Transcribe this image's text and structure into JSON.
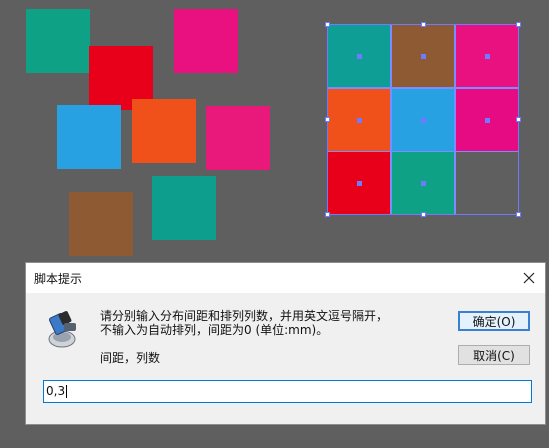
{
  "canvas": {
    "squares": [
      {
        "name": "teal-square",
        "color": "#0fa185"
      },
      {
        "name": "magenta-square",
        "color": "#e8117f"
      },
      {
        "name": "red-square",
        "color": "#e8001a"
      },
      {
        "name": "blue-square",
        "color": "#27a1e2"
      },
      {
        "name": "orange-square",
        "color": "#f0511a"
      },
      {
        "name": "pink-square",
        "color": "#e9197c"
      },
      {
        "name": "brown-square",
        "color": "#8e5a33"
      },
      {
        "name": "teal-square-2",
        "color": "#0e9e8e"
      }
    ],
    "grid_cells": [
      "#0e9e96",
      "#8e5a33",
      "#e8117f",
      "#f0511a",
      "#27a1e2",
      "#e60a83",
      "#e8001a",
      "#0fa185",
      ""
    ],
    "selection_color": "#6f7bff"
  },
  "dialog": {
    "title": "脚本提示",
    "close_glyph": "✕",
    "message_line1": "请分别输入分布间距和排列列数，并用英文逗号隔开，",
    "message_line2": "不输入为自动排列，间距为0 (单位:mm)。",
    "field_label": "间距，列数",
    "ok_label": "确定(O)",
    "cancel_label": "取消(C)",
    "input_value": "0,3"
  }
}
